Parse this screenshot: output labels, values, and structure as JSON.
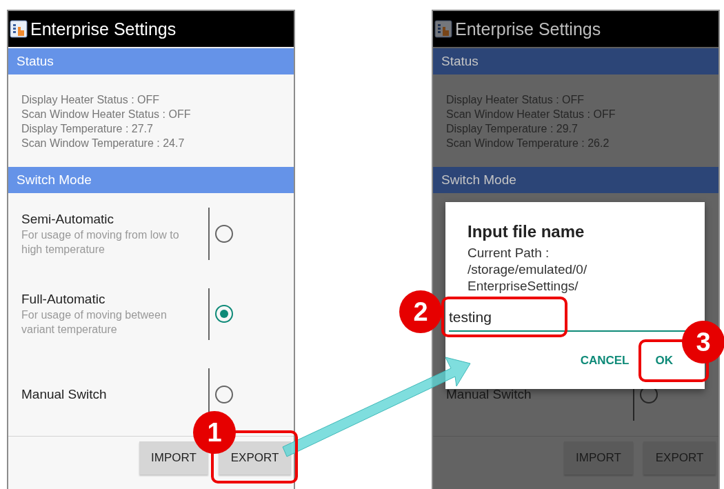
{
  "screens": [
    {
      "title": "Enterprise Settings",
      "dimmed": false,
      "status_header": "Status",
      "status_lines": [
        "Display Heater Status : OFF",
        "Scan Window Heater Status : OFF",
        "Display Temperature : 27.7",
        "Scan Window Temperature : 24.7"
      ],
      "mode_header": "Switch Mode",
      "modes": [
        {
          "title": "Semi-Automatic",
          "description": "For usage of moving from low to high temperature",
          "selected": false
        },
        {
          "title": "Full-Automatic",
          "description": "For usage of moving between variant temperature",
          "selected": true
        },
        {
          "title": "Manual Switch",
          "selected": false
        }
      ],
      "buttons": [
        "IMPORT",
        "EXPORT"
      ]
    },
    {
      "title": "Enterprise Settings",
      "dimmed": true,
      "status_header": "Status",
      "status_lines": [
        "Display Heater Status : OFF",
        "Scan Window Heater Status : OFF",
        "Display Temperature : 29.7",
        "Scan Window Temperature : 26.2"
      ],
      "mode_header": "Switch Mode",
      "modes": [
        {
          "title": "Manual Switch",
          "selected": false
        }
      ],
      "buttons": [
        "IMPORT",
        "EXPORT"
      ],
      "dialog": {
        "title": "Input file name",
        "path_lines": [
          "Current Path :",
          "/storage/emulated/0/",
          "EnterpriseSettings/"
        ],
        "value": "testing",
        "actions": [
          "CANCEL",
          "OK"
        ]
      }
    }
  ],
  "callouts": [
    {
      "number": "1"
    },
    {
      "number": "2"
    },
    {
      "number": "3"
    }
  ]
}
